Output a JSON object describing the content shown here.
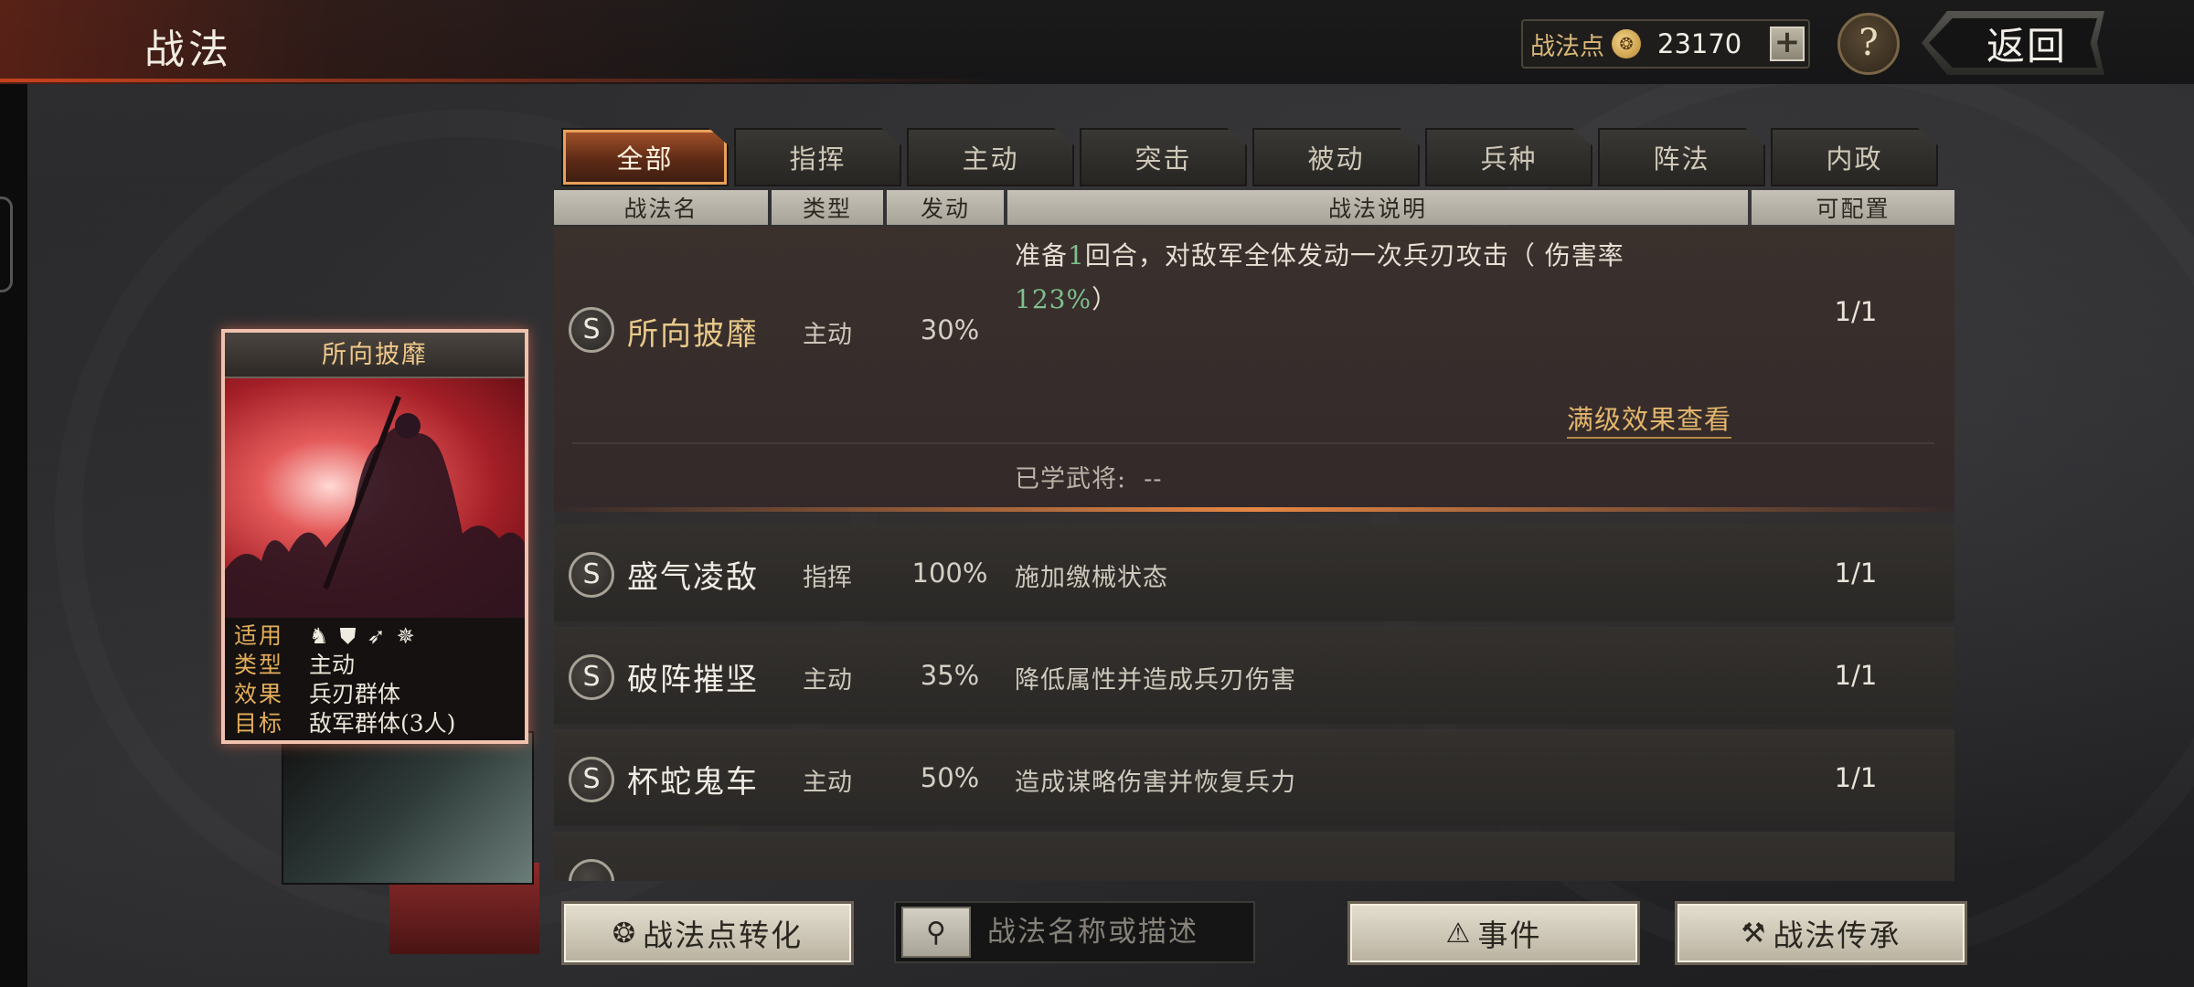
{
  "header": {
    "title": "战法",
    "points_label": "战法点",
    "points_value": "23170",
    "plus_label": "+",
    "help_label": "?",
    "back_label": "返回"
  },
  "tabs": [
    {
      "label": "全部",
      "active": true
    },
    {
      "label": "指挥"
    },
    {
      "label": "主动"
    },
    {
      "label": "突击"
    },
    {
      "label": "被动"
    },
    {
      "label": "兵种"
    },
    {
      "label": "阵法"
    },
    {
      "label": "内政"
    }
  ],
  "columns": [
    "战法名",
    "类型",
    "发动",
    "战法说明",
    "可配置"
  ],
  "selected": {
    "badge": "S",
    "name": "所向披靡",
    "type": "主动",
    "rate": "30%",
    "desc_prefix": "准备",
    "desc_round": "1",
    "desc_mid": "回合，对敌军全体发动一次兵刃攻击（ 伤害率",
    "desc_rate": "123%",
    "desc_suffix": "）",
    "config": "1/1",
    "max_level_link": "满级效果查看",
    "learned_label": "已学武将:",
    "learned_value": "--"
  },
  "rows": [
    {
      "badge": "S",
      "name": "盛气凌敌",
      "type": "指挥",
      "rate": "100%",
      "desc": "施加缴械状态",
      "config": "1/1"
    },
    {
      "badge": "S",
      "name": "破阵摧坚",
      "type": "主动",
      "rate": "35%",
      "desc": "降低属性并造成兵刃伤害",
      "config": "1/1"
    },
    {
      "badge": "S",
      "name": "杯蛇鬼车",
      "type": "主动",
      "rate": "50%",
      "desc": "造成谋略伤害并恢复兵力",
      "config": "1/1"
    }
  ],
  "card": {
    "title": "所向披靡",
    "applicable_key": "适用",
    "type_key": "类型",
    "type_val": "主动",
    "effect_key": "效果",
    "effect_val": "兵刃群体",
    "target_key": "目标",
    "target_val": "敌军群体(3人)"
  },
  "bottom": {
    "convert_label": "战法点转化",
    "search_placeholder": "战法名称或描述",
    "event_label": "事件",
    "inherit_label": "战法传承"
  },
  "colors": {
    "accent_orange": "#e9a05a",
    "gold_text": "#e2b66c",
    "green_number": "#7fc08e"
  }
}
